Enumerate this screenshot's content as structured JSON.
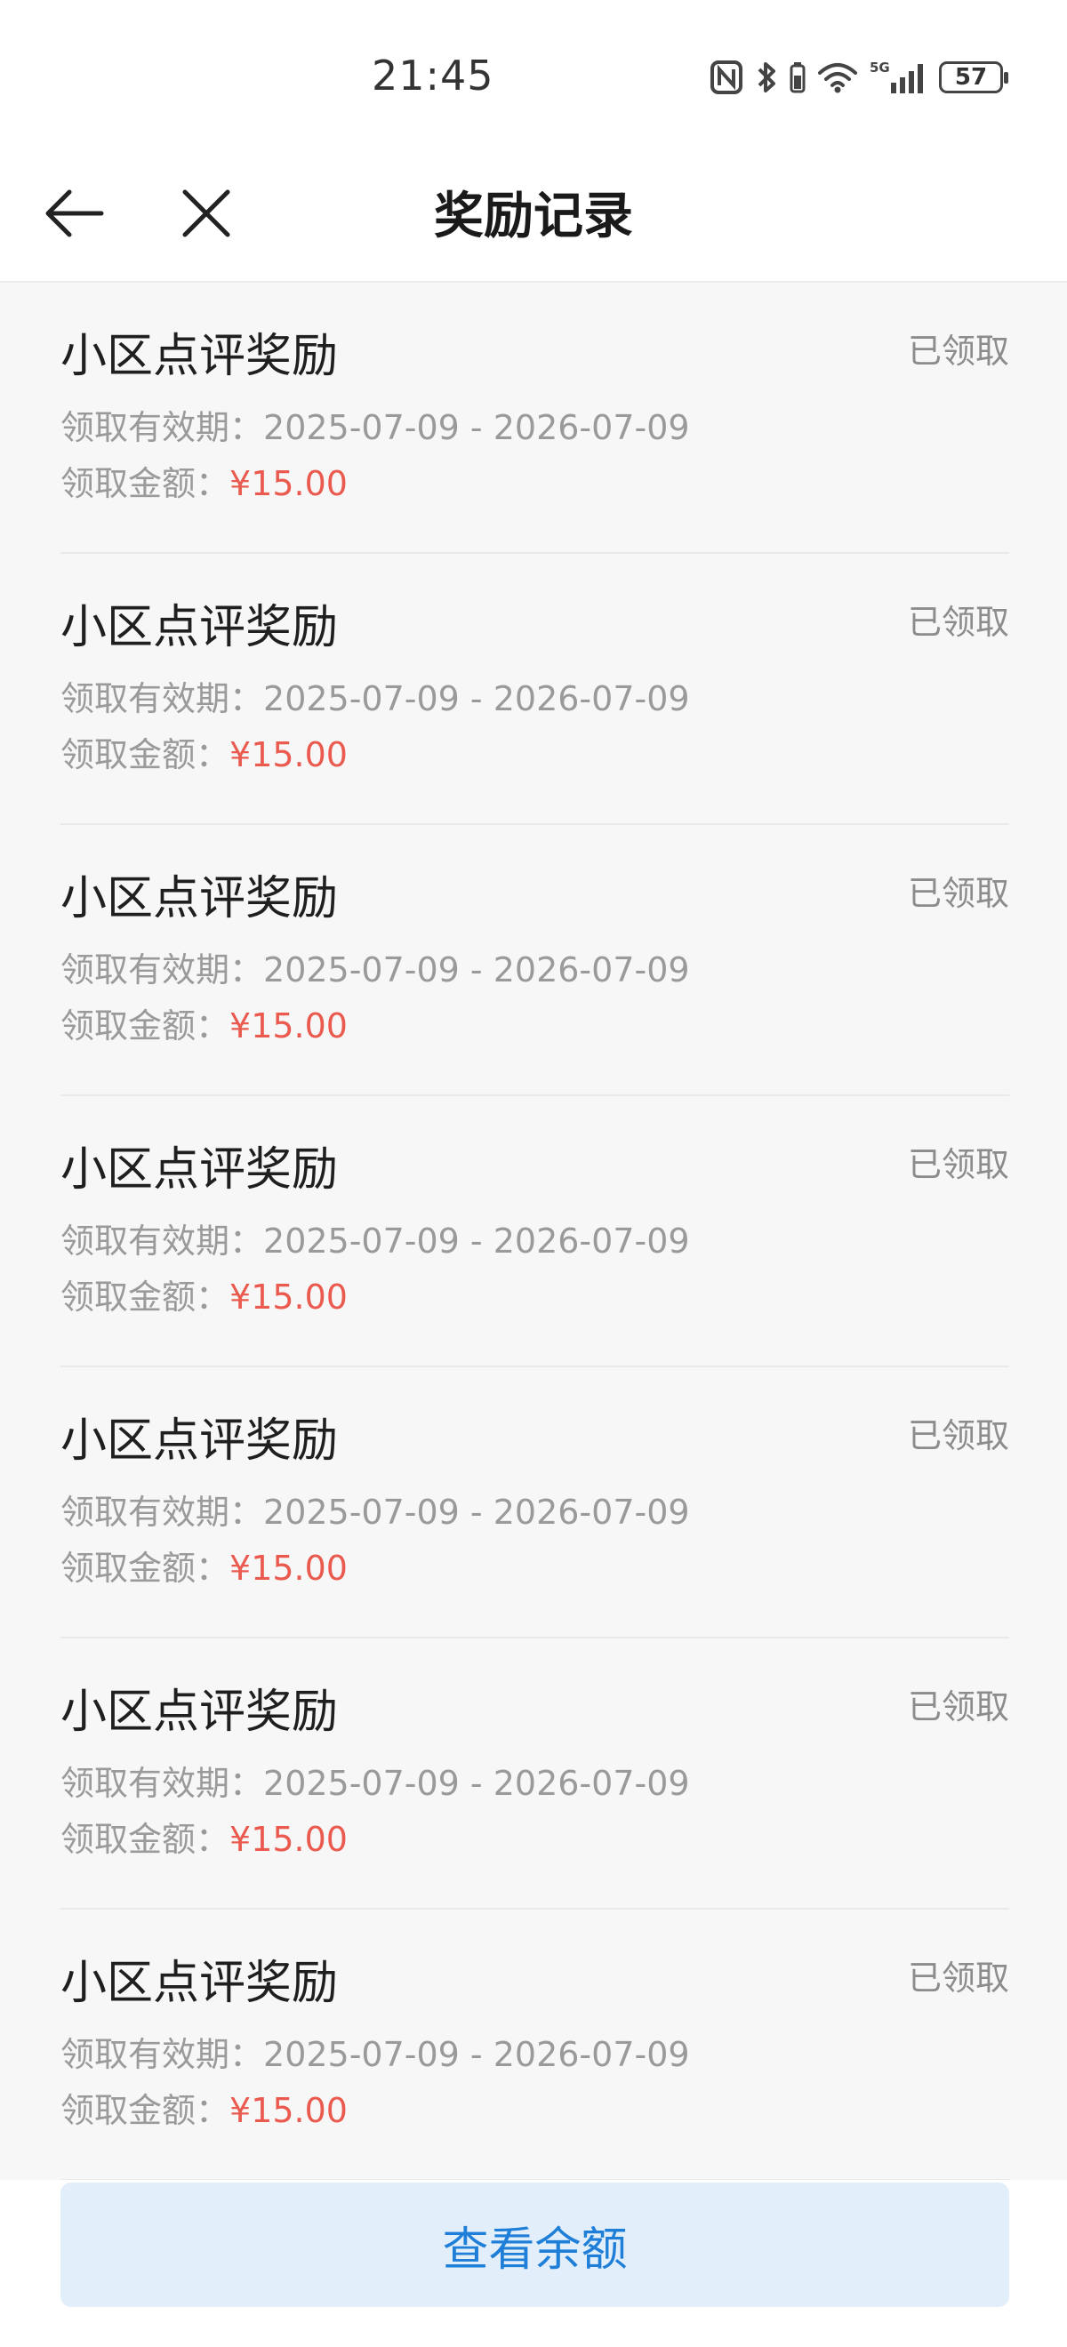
{
  "status_bar": {
    "time": "21:45",
    "network": "5G",
    "battery": "57",
    "icons": [
      "nfc-icon",
      "bluetooth-icon",
      "wifi-icon",
      "signal-icon",
      "battery-icon"
    ]
  },
  "nav": {
    "title": "奖励记录",
    "back_icon": "arrow-left-icon",
    "close_icon": "close-icon"
  },
  "records": [
    {
      "title": "小区点评奖励",
      "status": "已领取",
      "validity_label": "领取有效期：",
      "validity": "2025-07-09 - 2026-07-09",
      "amount_label": "领取金额：",
      "amount": "¥15.00"
    },
    {
      "title": "小区点评奖励",
      "status": "已领取",
      "validity_label": "领取有效期：",
      "validity": "2025-07-09 - 2026-07-09",
      "amount_label": "领取金额：",
      "amount": "¥15.00"
    },
    {
      "title": "小区点评奖励",
      "status": "已领取",
      "validity_label": "领取有效期：",
      "validity": "2025-07-09 - 2026-07-09",
      "amount_label": "领取金额：",
      "amount": "¥15.00"
    },
    {
      "title": "小区点评奖励",
      "status": "已领取",
      "validity_label": "领取有效期：",
      "validity": "2025-07-09 - 2026-07-09",
      "amount_label": "领取金额：",
      "amount": "¥15.00"
    },
    {
      "title": "小区点评奖励",
      "status": "已领取",
      "validity_label": "领取有效期：",
      "validity": "2025-07-09 - 2026-07-09",
      "amount_label": "领取金额：",
      "amount": "¥15.00"
    },
    {
      "title": "小区点评奖励",
      "status": "已领取",
      "validity_label": "领取有效期：",
      "validity": "2025-07-09 - 2026-07-09",
      "amount_label": "领取金额：",
      "amount": "¥15.00"
    },
    {
      "title": "小区点评奖励",
      "status": "已领取",
      "validity_label": "领取有效期：",
      "validity": "2025-07-09 - 2026-07-09",
      "amount_label": "领取金额：",
      "amount": "¥15.00"
    }
  ],
  "footer": {
    "balance_button": "查看余额"
  },
  "colors": {
    "amount": "#ea5a4f",
    "button_bg": "#e2effb",
    "button_text": "#1f7fd8"
  }
}
